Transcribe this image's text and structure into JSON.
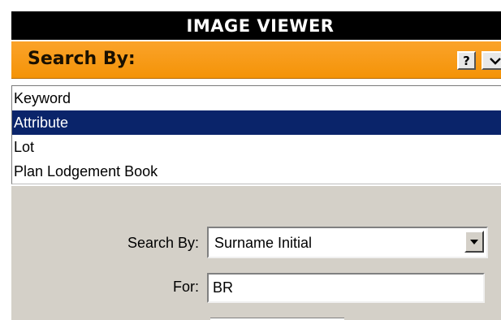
{
  "viewer": {
    "title": "IMAGE VIEWER"
  },
  "search_panel": {
    "header_label": "Search By:",
    "help_label": "?",
    "help_icon": "question-icon",
    "collapse_icon": "chevron-down-icon",
    "modes": [
      {
        "label": "Keyword",
        "selected": false
      },
      {
        "label": "Attribute",
        "selected": true
      },
      {
        "label": "Lot",
        "selected": false
      },
      {
        "label": "Plan Lodgement Book",
        "selected": false
      }
    ]
  },
  "form": {
    "search_by_label": "Search By:",
    "search_by_value": "Surname Initial",
    "for_label": "For:",
    "for_value": "BR"
  },
  "colors": {
    "title_bar": "#000000",
    "header_orange": "#f49307",
    "selection": "#0a246a",
    "panel_gray": "#d4d0c8"
  }
}
